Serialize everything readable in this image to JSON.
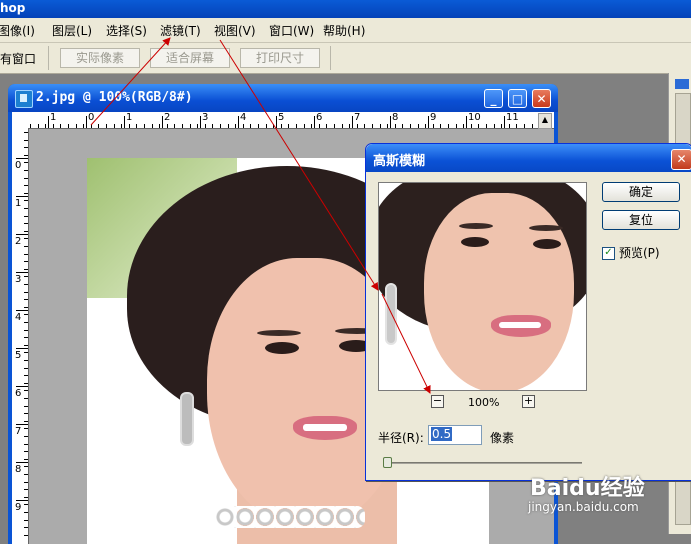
{
  "app": {
    "title_fragment": "hop"
  },
  "menubar": {
    "items": [
      {
        "label": "图像(I)"
      },
      {
        "label": "图层(L)"
      },
      {
        "label": "选择(S)"
      },
      {
        "label": "滤镜(T)"
      },
      {
        "label": "视图(V)"
      },
      {
        "label": "窗口(W)"
      },
      {
        "label": "帮助(H)"
      }
    ]
  },
  "options_bar": {
    "lead_text": "有窗口",
    "buttons": [
      {
        "label": "实际像素"
      },
      {
        "label": "适合屏幕"
      },
      {
        "label": "打印尺寸"
      }
    ]
  },
  "document": {
    "title": "2.jpg @ 100%(RGB/8#)",
    "ruler_h": [
      "1",
      "0",
      "1",
      "2",
      "3",
      "4",
      "5",
      "6",
      "7",
      "8",
      "9",
      "10",
      "11"
    ],
    "ruler_v": [
      "0",
      "1",
      "2",
      "3",
      "4",
      "5",
      "6",
      "7",
      "8",
      "9"
    ]
  },
  "dialog": {
    "title": "高斯模糊",
    "ok_label": "确定",
    "reset_label": "复位",
    "preview_label": "预览(P)",
    "preview_checked": true,
    "zoom_out": "−",
    "zoom_in": "+",
    "zoom_level": "100%",
    "radius_label": "半径(R):",
    "radius_value": "0.5",
    "radius_unit": "像素",
    "radius_slider_fraction": 0.0
  },
  "watermark": {
    "brand": "Baidu经验",
    "url": "jingyan.baidu.com"
  },
  "colors": {
    "xp_blue": "#0a54d5",
    "annotation_arrow": "#cc0000"
  }
}
